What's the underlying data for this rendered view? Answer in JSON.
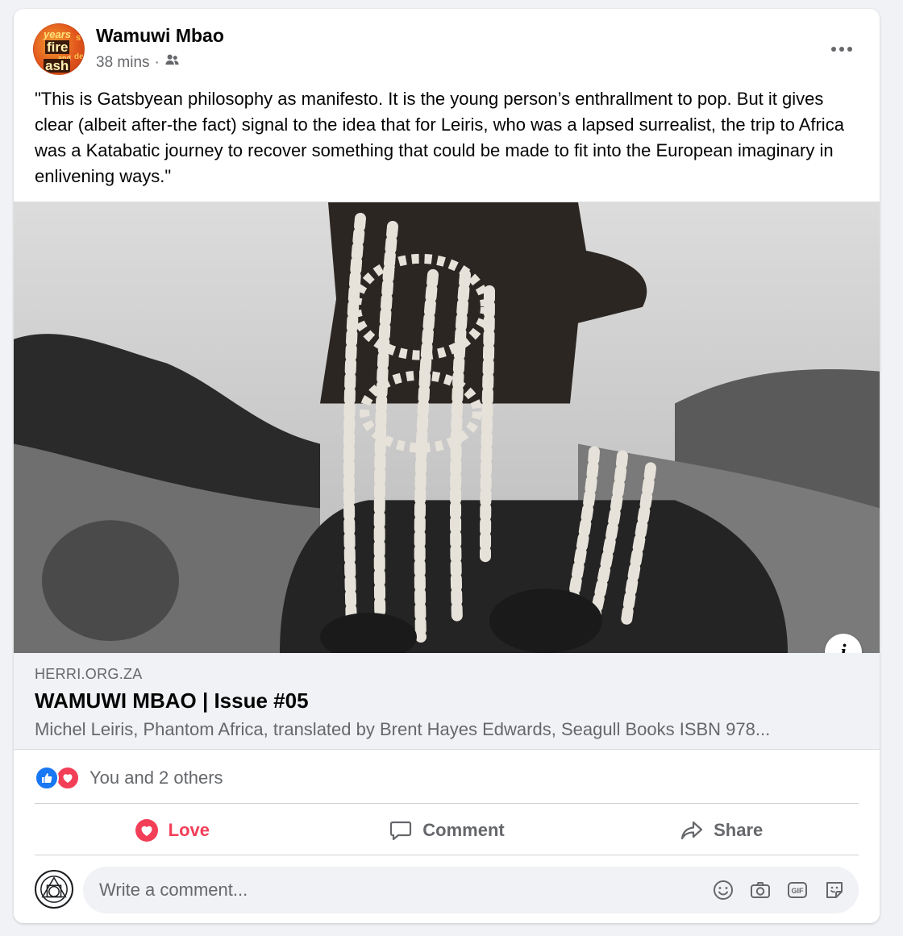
{
  "post": {
    "author": "Wamuwi Mbao",
    "timestamp": "38 mins",
    "separator": "·",
    "audience_icon": "friends-icon",
    "avatar_text": {
      "line1": "years",
      "line2": "fire",
      "line3": "and",
      "line4": "ash",
      "side1": "s",
      "side2": "de"
    },
    "text": "\"This is Gatsbyean philosophy as manifesto. It is the young person’s enthrallment to pop. But it gives clear (albeit after-the fact) signal to the idea that for Leiris, who was a lapsed surrealist, the trip to Africa was a Katabatic journey to recover something that could be made to fit into the European imaginary in enlivening ways.\""
  },
  "link_preview": {
    "domain": "HERRI.ORG.ZA",
    "title": "WAMUWI MBAO | Issue #05",
    "description": "Michel Leiris, Phantom Africa, translated by Brent Hayes Edwards, Seagull Books ISBN 978...",
    "info_label": "i"
  },
  "reactions": {
    "summary": "You and 2 others",
    "types": [
      "like",
      "love"
    ]
  },
  "actions": {
    "love": "Love",
    "comment": "Comment",
    "share": "Share"
  },
  "comment_box": {
    "placeholder": "Write a comment...",
    "tools": [
      "emoji-icon",
      "camera-icon",
      "gif-icon",
      "sticker-icon"
    ],
    "gif_label": "GIF"
  },
  "colors": {
    "love": "#f33e58",
    "like": "#1877f2",
    "secondary_text": "#65676b",
    "background": "#f0f2f5"
  }
}
